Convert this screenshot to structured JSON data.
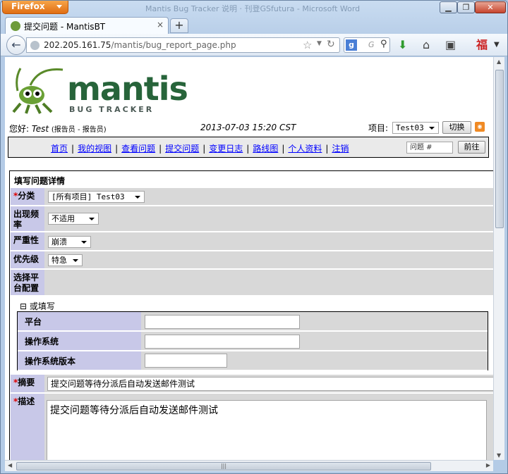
{
  "browser": {
    "app_button": "Firefox",
    "window_title": "Mantis Bug Tracker 说明 · 刊登GSfutura - Microsoft Word",
    "tab_title": "提交问题 - MantisBT",
    "tab_close": "×",
    "new_tab": "+",
    "url_host": "202.205.161.75",
    "url_path": "/mantis/bug_report_page.php",
    "search_placeholder": "G",
    "icons": [
      "back-arrow-icon",
      "globe-icon",
      "bookmark-star-icon",
      "reload-icon",
      "google-icon",
      "search-icon",
      "download-icon",
      "home-icon",
      "bookmarks-icon",
      "fu-icon",
      "menu-icon"
    ]
  },
  "header": {
    "logo_word": "mantis",
    "logo_sub": "BUG TRACKER",
    "greeting_prefix": "您好:",
    "user": "Test",
    "role": "(报告员 - 报告员)",
    "datetime": "2013-07-03 15:20 CST",
    "project_label": "项目:",
    "project_value": "Test03",
    "switch_button": "切换"
  },
  "menu": {
    "items": [
      "首页",
      "我的视图",
      "查看问题",
      "提交问题",
      "变更日志",
      "路线图",
      "个人资料",
      "注销"
    ],
    "issue_placeholder": "问题 #",
    "go_button": "前往"
  },
  "form": {
    "title": "填写问题详情",
    "required_mark": "*",
    "category_label": "分类",
    "category_value": "[所有项目] Test03",
    "frequency_label": "出现频率",
    "frequency_value": "不适用",
    "severity_label": "严重性",
    "severity_value": "崩溃",
    "priority_label": "优先级",
    "priority_value": "特急",
    "platform_profile_label": "选择平台配置",
    "or_fill_toggle": "⊟",
    "or_fill_label": "或填写",
    "platform_label": "平台",
    "os_label": "操作系统",
    "os_version_label": "操作系统版本",
    "summary_label": "摘要",
    "summary_value": "提交问题等待分派后自动发送邮件测试",
    "description_label": "描述",
    "description_value": "提交问题等待分派后自动发送邮件测试"
  },
  "colors": {
    "label_bg": "#c8c8e8",
    "row_bg": "#d8d8d8",
    "link": "#0000ff",
    "required": "#dd0000"
  }
}
